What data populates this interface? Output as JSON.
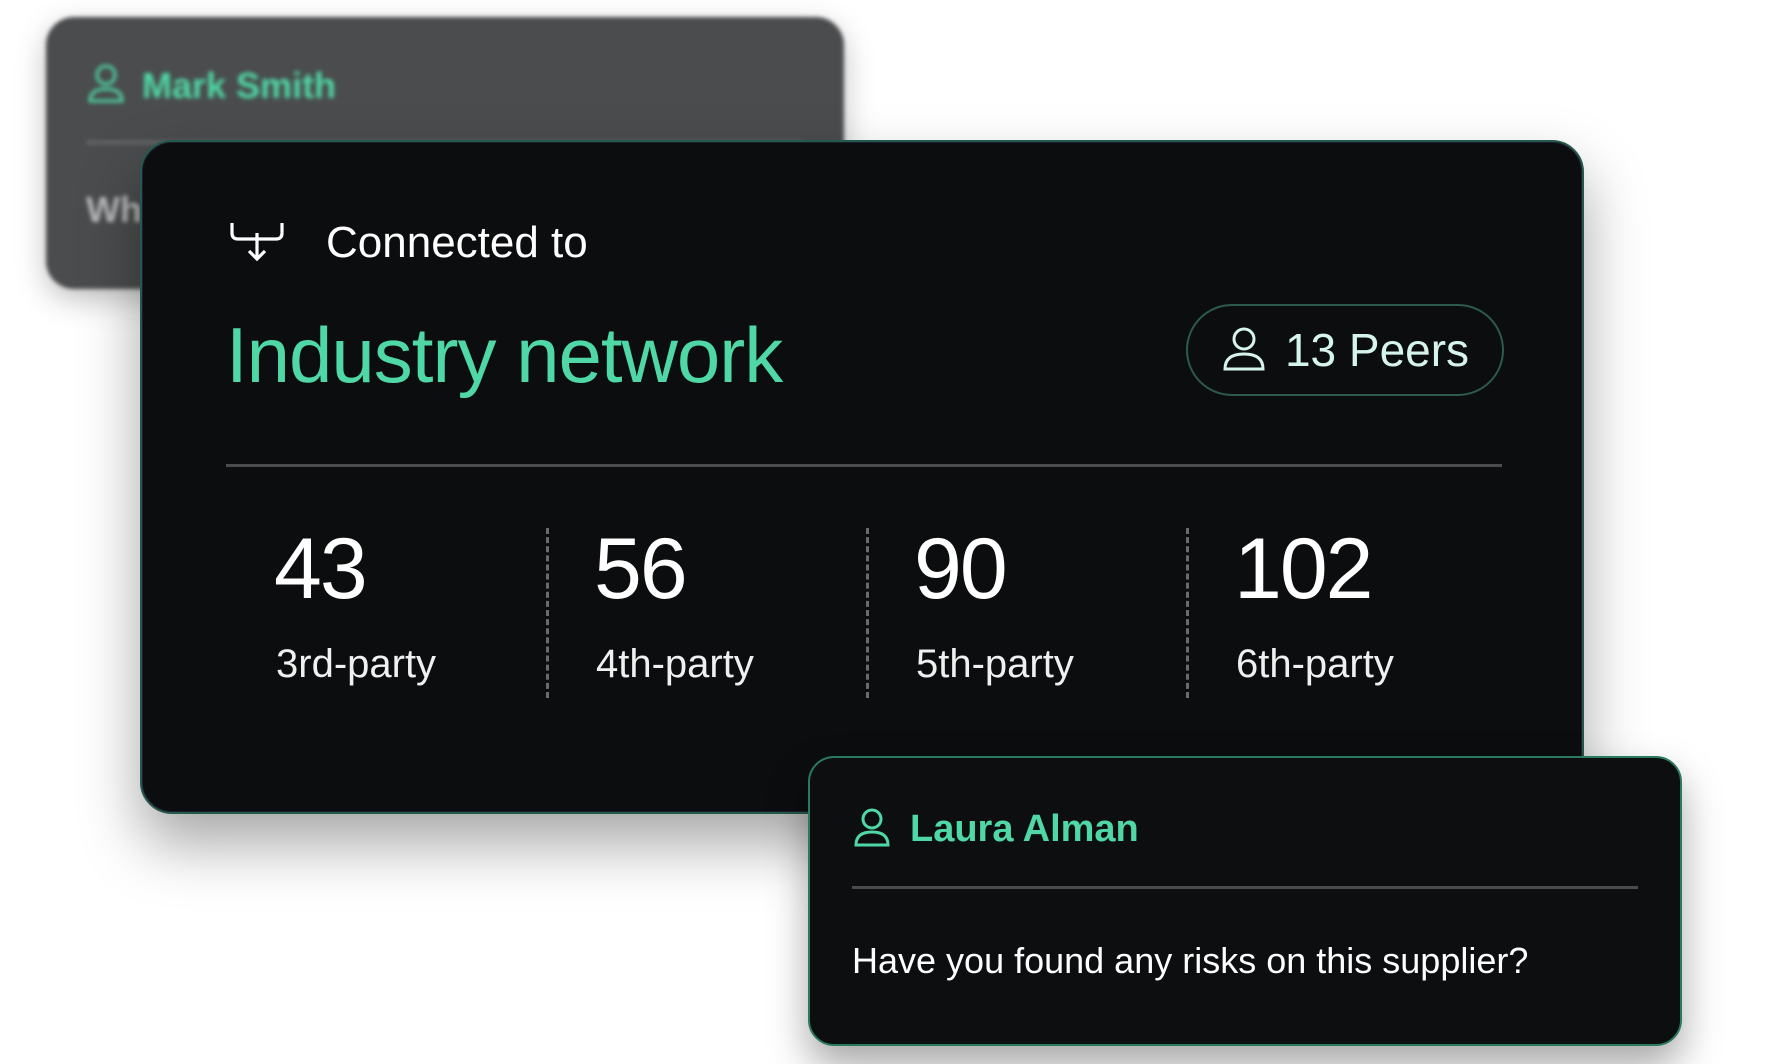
{
  "background_card": {
    "name": "Mark Smith",
    "message_fragment": "Wh"
  },
  "main_card": {
    "connected_label": "Connected to",
    "network_title": "Industry network",
    "peers_label": "13 Peers",
    "stats": [
      {
        "value": "43",
        "label": "3rd-party"
      },
      {
        "value": "56",
        "label": "4th-party"
      },
      {
        "value": "90",
        "label": "5th-party"
      },
      {
        "value": "102",
        "label": "6th-party"
      }
    ]
  },
  "chat_card": {
    "name": "Laura Alman",
    "message": "Have you found any risks on this supplier?"
  },
  "icons": {
    "connected": "connection-icon",
    "user": "user-icon"
  },
  "colors": {
    "accent": "#4fd8a6",
    "card_bg": "#0c0d0f",
    "border": "#2c7a5e"
  }
}
